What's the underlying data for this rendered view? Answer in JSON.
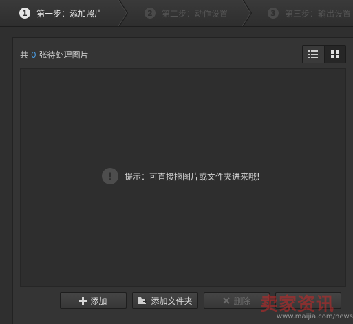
{
  "steps": [
    {
      "num": "1",
      "label": "第一步：添加照片",
      "state": "active"
    },
    {
      "num": "2",
      "label": "第二步：动作设置",
      "state": "inactive"
    },
    {
      "num": "3",
      "label": "第三步：输出设置",
      "state": "inactive"
    }
  ],
  "panel": {
    "count_prefix": "共",
    "count": "0",
    "count_suffix": "张待处理图片",
    "view_mode": "grid"
  },
  "hint": {
    "icon": "!",
    "text": "提示：可直接拖图片或文件夹进来哦!"
  },
  "buttons": {
    "add": "添加",
    "add_folder": "添加文件夹",
    "delete": "删除"
  },
  "watermark": {
    "text": "卖家资讯",
    "url": "www.maijia.com/news"
  },
  "colors": {
    "accent": "#4a9be0",
    "background": "#2f2f2f"
  }
}
